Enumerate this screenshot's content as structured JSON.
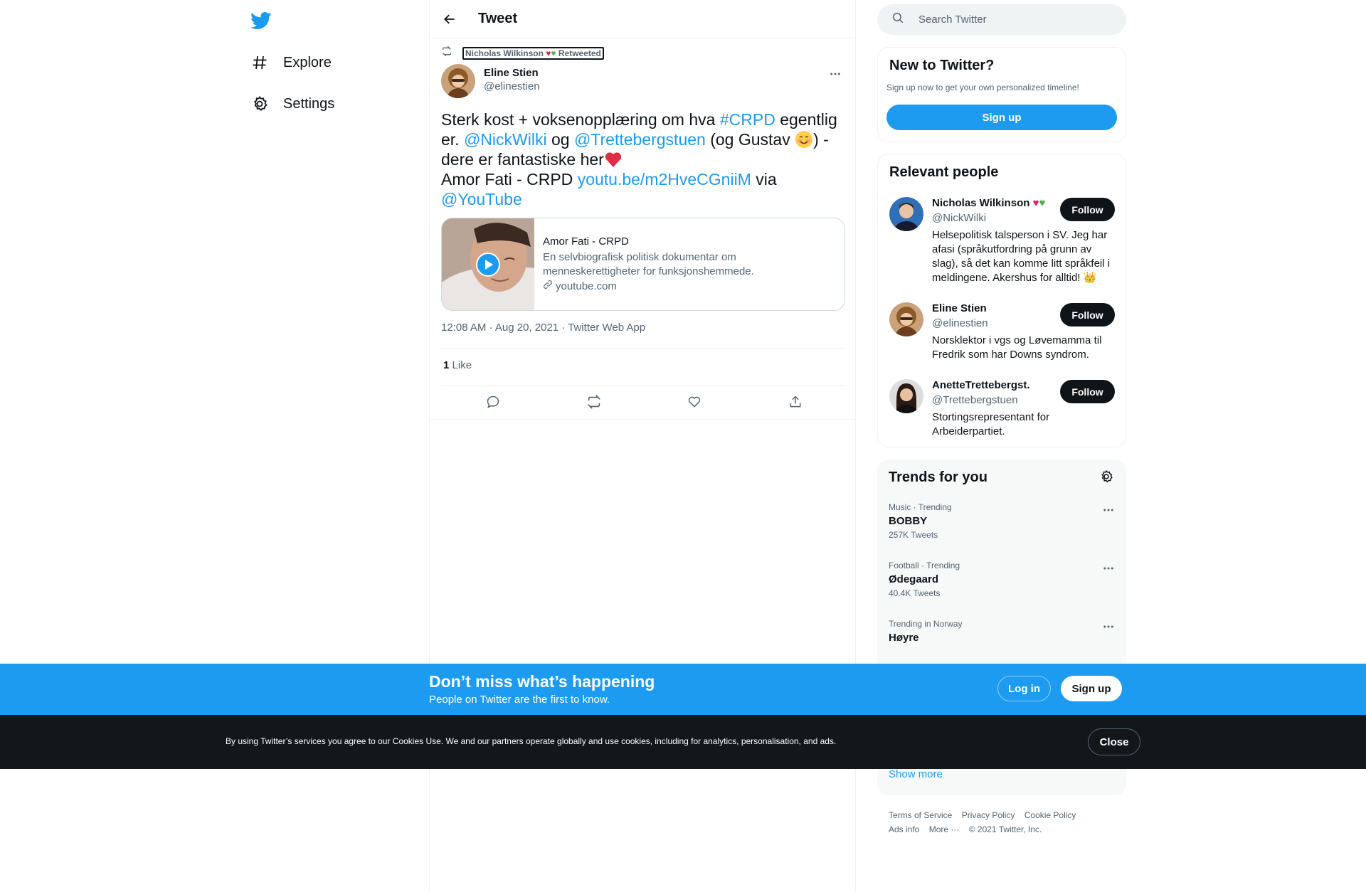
{
  "nav": {
    "items": [
      {
        "label": "Explore",
        "icon": "hashtag-icon"
      },
      {
        "label": "Settings",
        "icon": "gear-icon"
      }
    ]
  },
  "header": {
    "title": "Tweet"
  },
  "tweet": {
    "retweeted_by": "Nicholas Wilkinson",
    "retweeted_suffix": "Retweeted",
    "author_name": "Eline Stien",
    "author_handle": "@elinestien",
    "text": {
      "p1": "Sterk kost + voksenopplæring om hva ",
      "hashtag": "#CRPD",
      "p2": " egentlig er. ",
      "mention1": "@NickWilki",
      "p3": " og ",
      "mention2": "@Trettebergstuen",
      "p4": " (og Gustav ",
      "p5": ") - dere er fantastiske her",
      "p6": "Amor Fati - CRPD ",
      "link": "youtu.be/m2HveCGniiM",
      "p7": " via ",
      "mention3": "@YouTube"
    },
    "card": {
      "title": "Amor Fati - CRPD",
      "description": "En selvbiografisk politisk dokumentar om menneskerettigheter for funksjonshemmede.",
      "domain": "youtube.com"
    },
    "meta": "12:08 AM · Aug 20, 2021 · Twitter Web App",
    "like_count": "1",
    "like_label": "Like"
  },
  "search": {
    "placeholder": "Search Twitter"
  },
  "new_to_twitter": {
    "title": "New to Twitter?",
    "subtitle": "Sign up now to get your own personalized timeline!",
    "button": "Sign up"
  },
  "relevant_people": {
    "title": "Relevant people",
    "people": [
      {
        "name": "Nicholas Wilkinson",
        "handle": "@NickWilki",
        "bio": "Helsepolitisk talsperson i SV. Jeg har afasi (språkutfordring på grunn av slag), så det kan komme litt språkfeil i meldingene. Akershus for alltid! 👑",
        "button": "Follow"
      },
      {
        "name": "Eline Stien",
        "handle": "@elinestien",
        "bio": "Norsklektor i vgs og Løvemamma til Fredrik som har Downs syndrom.",
        "button": "Follow"
      },
      {
        "name": "AnetteTrettebergst.",
        "handle": "@Trettebergstuen",
        "bio": "Stortingsrepresentant for Arbeiderpartiet.",
        "button": "Follow"
      }
    ]
  },
  "trends": {
    "title": "Trends for you",
    "items": [
      {
        "context": "Music · Trending",
        "name": "BOBBY",
        "count": "257K Tweets"
      },
      {
        "context": "Football · Trending",
        "name": "Ødegaard",
        "count": "40.4K Tweets"
      },
      {
        "context": "Trending in Norway",
        "name": "Høyre",
        "count": ""
      }
    ],
    "show_more": "Show more"
  },
  "footer": {
    "terms": "Terms of Service",
    "privacy": "Privacy Policy",
    "cookie": "Cookie Policy",
    "ads": "Ads info",
    "more": "More ···",
    "copyright": "© 2021 Twitter, Inc."
  },
  "banner": {
    "title": "Don’t miss what’s happening",
    "subtitle": "People on Twitter are the first to know.",
    "login": "Log in",
    "signup": "Sign up"
  },
  "cookie": {
    "text": "By using Twitter’s services you agree to our Cookies Use. We and our partners operate globally and use cookies, including for analytics, personalisation, and ads.",
    "close": "Close"
  },
  "colors": {
    "accent": "#1d9bf0",
    "text": "#0f1419",
    "muted": "#536471",
    "heart": "#e0245e"
  }
}
